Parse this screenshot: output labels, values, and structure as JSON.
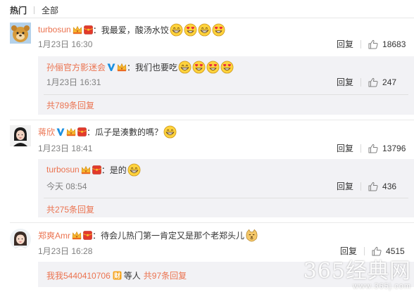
{
  "tabs": [
    {
      "label": "热门",
      "active": true
    },
    {
      "label": "全部",
      "active": false
    }
  ],
  "icon_names": {
    "crown": "vip-crown-icon",
    "red": "red-envelope-icon",
    "verified": "blue-v-verified-icon",
    "grin": "grin-emoji-icon",
    "heart_eyes": "heart-eyes-emoji-icon",
    "doge": "doge-emoji-icon",
    "like": "thumbs-up-icon",
    "wealth": "wealth-badge-icon"
  },
  "colors": {
    "username": "#eb7350",
    "link": "#eb7350",
    "reply_bg": "#f2f2f5",
    "verified": "#1a8fe0"
  },
  "comments": [
    {
      "user": "turbosun",
      "text": "：我最爱，酸汤水饺",
      "time": "1月23日 16:30",
      "reply_label": "回复",
      "likes": "18683",
      "sub": {
        "user": "孙俪官方影迷会",
        "text": "：我们也要吃",
        "time": "1月23日 16:31",
        "reply_label": "回复",
        "likes": "247"
      },
      "more": "共789条回复"
    },
    {
      "user": "蒋欣",
      "text": "：瓜子是湊數的嗎？",
      "time": "1月23日 18:41",
      "reply_label": "回复",
      "likes": "13796",
      "sub": {
        "user": "turbosun",
        "text": "：是的",
        "time": "今天 08:54",
        "reply_label": "回复",
        "likes": "436"
      },
      "more": "共275条回复"
    },
    {
      "user": "郑爽Amr",
      "text": "：待会儿热门第一肯定又是那个老郑头儿",
      "time": "1月23日 16:28",
      "reply_label": "回复",
      "likes": "4515",
      "more_user": "我我5440410706",
      "more_mid": "等人",
      "more_count": "共97条回复"
    }
  ],
  "watermark": {
    "big": "365经典网",
    "small": "www.365j.com"
  }
}
